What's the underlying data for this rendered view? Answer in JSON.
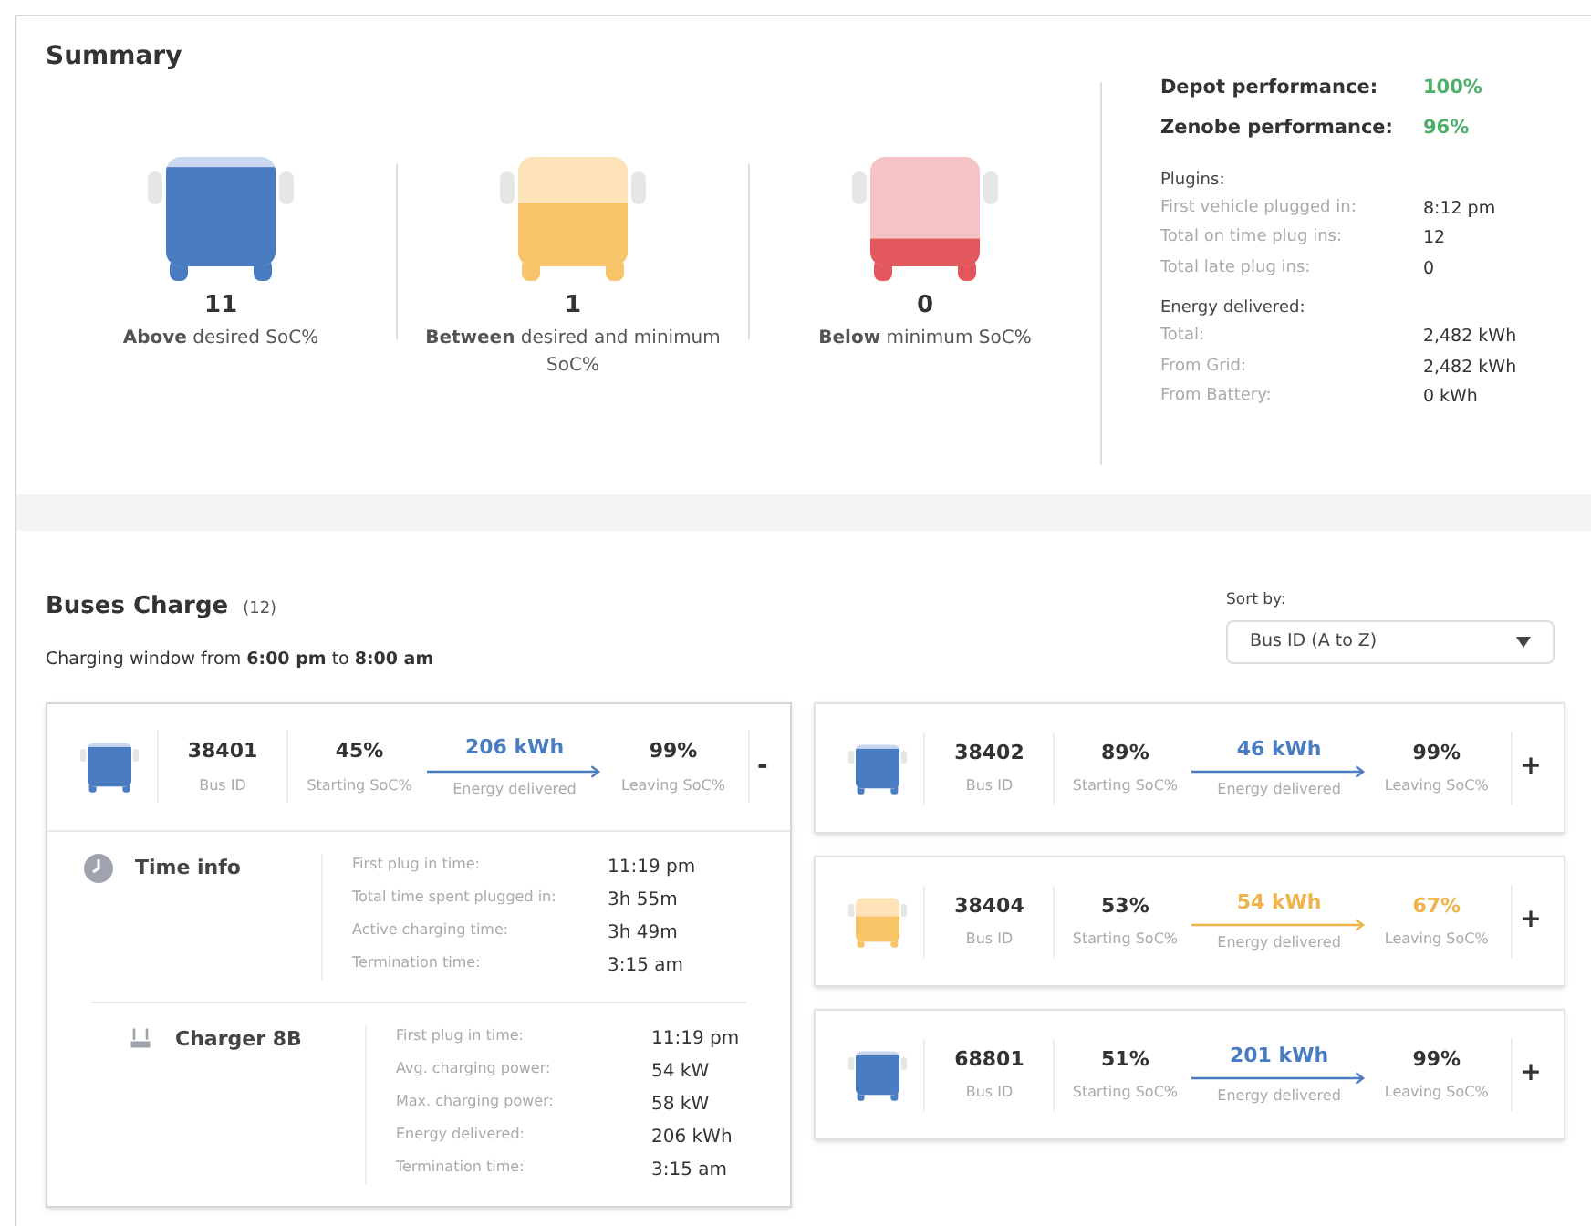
{
  "summary": {
    "title": "Summary",
    "groups": [
      {
        "kind": "above",
        "count": "11",
        "label": "**Above** desired SoC%"
      },
      {
        "kind": "between",
        "count": "1",
        "label": "**Between** desired and minimum SoC%"
      },
      {
        "kind": "below",
        "count": "0",
        "label": "**Below** minimum SoC%"
      }
    ],
    "performance": [
      {
        "label": "Depot performance:",
        "value": "100%"
      },
      {
        "label": "Zenobe performance:",
        "value": "96%"
      }
    ],
    "stat_groups": [
      {
        "title": "Plugins:",
        "rows": [
          {
            "label": "First vehicle plugged in:",
            "value": "8:12 pm"
          },
          {
            "label": "Total on time plug ins:",
            "value": "12"
          },
          {
            "label": "Total late plug ins:",
            "value": "0"
          }
        ]
      },
      {
        "title": "Energy delivered:",
        "rows": [
          {
            "label": "Total:",
            "value": "2,482 kWh"
          },
          {
            "label": "From Grid:",
            "value": "2,482 kWh"
          },
          {
            "label": "From Battery:",
            "value": "0 kWh"
          }
        ]
      }
    ]
  },
  "buses": {
    "title": "Buses Charge",
    "count": "(12)",
    "window": "Charging window from **6:00 pm** to **8:00 am**",
    "sort_label": "Sort by:",
    "sort_value": "Bus ID (A to Z)",
    "cards": [
      {
        "kind": "above",
        "bus_id": "38401",
        "bus_id_label": "Bus ID",
        "start": "45%",
        "start_label": "Starting SoC%",
        "energy": "206 kWh",
        "energy_label": "Energy delivered",
        "leave": "99%",
        "leave_label": "Leaving SoC%",
        "toggle": "-",
        "expanded": true,
        "sections": [
          {
            "kind": "clock",
            "title": "Time info",
            "rows": [
              {
                "label": "First plug in time:",
                "value": "11:19 pm"
              },
              {
                "label": "Total time spent plugged in:",
                "value": "3h 55m"
              },
              {
                "label": "Active charging time:",
                "value": "3h 49m"
              },
              {
                "label": "Termination time:",
                "value": "3:15 am"
              }
            ]
          },
          {
            "kind": "charger",
            "title": "Charger 8B",
            "rows": [
              {
                "label": "First plug in time:",
                "value": "11:19 pm"
              },
              {
                "label": "Avg. charging power:",
                "value": "54 kW"
              },
              {
                "label": "Max. charging power:",
                "value": "58 kW"
              },
              {
                "label": "Energy delivered:",
                "value": "206 kWh"
              },
              {
                "label": "Termination time:",
                "value": "3:15 am"
              }
            ]
          }
        ]
      },
      {
        "kind": "above",
        "bus_id": "38402",
        "bus_id_label": "Bus ID",
        "start": "89%",
        "start_label": "Starting SoC%",
        "energy": "46 kWh",
        "energy_label": "Energy delivered",
        "leave": "99%",
        "leave_label": "Leaving SoC%",
        "toggle": "+",
        "expanded": false
      },
      {
        "kind": "between",
        "bus_id": "38404",
        "bus_id_label": "Bus ID",
        "start": "53%",
        "start_label": "Starting SoC%",
        "energy": "54 kWh",
        "energy_label": "Energy delivered",
        "leave": "67%",
        "leave_label": "Leaving SoC%",
        "toggle": "+",
        "expanded": false
      },
      {
        "kind": "above",
        "bus_id": "68801",
        "bus_id_label": "Bus ID",
        "start": "51%",
        "start_label": "Starting SoC%",
        "energy": "201 kWh",
        "energy_label": "Energy delivered",
        "leave": "99%",
        "leave_label": "Leaving SoC%",
        "toggle": "+",
        "expanded": false
      }
    ]
  }
}
